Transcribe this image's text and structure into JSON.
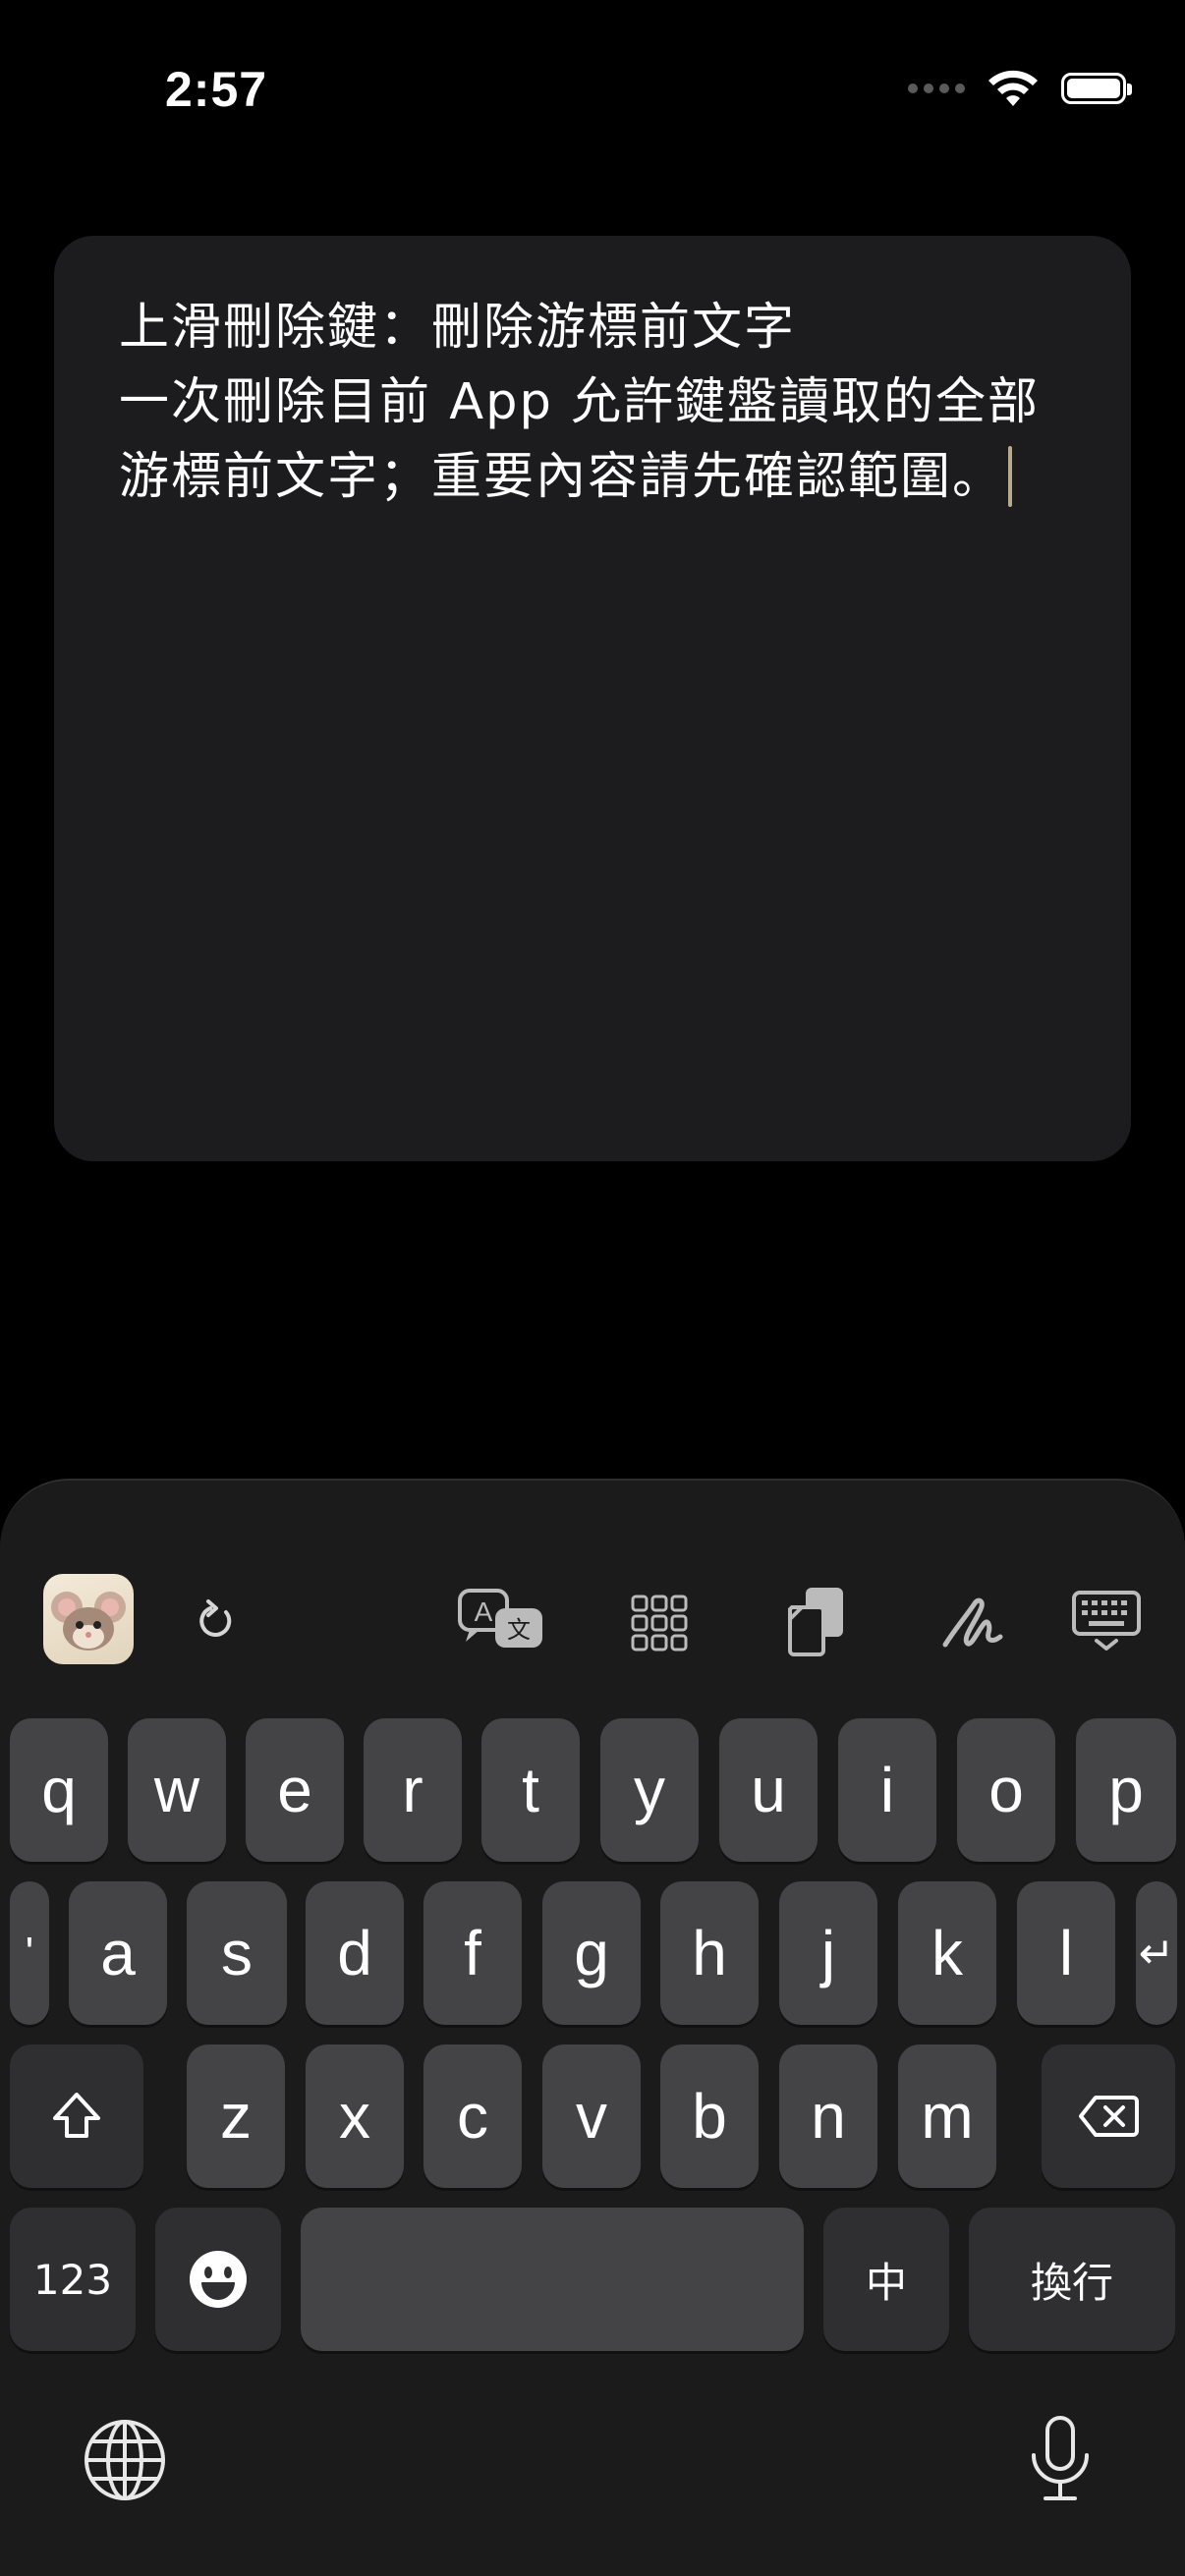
{
  "status_bar": {
    "time": "2:57"
  },
  "text_area": {
    "content": "上滑刪除鍵：刪除游標前文字\n一次刪除目前 App 允許鍵盤讀取的全部游標前文字；重要內容請先確認範圍。"
  },
  "keyboard": {
    "toolbar": {
      "icons": [
        "mouse-avatar-icon",
        "refresh-icon",
        "translate-icon",
        "grid-apps-icon",
        "clipboard-icon",
        "handwriting-icon",
        "hide-keyboard-icon"
      ]
    },
    "row1": [
      "q",
      "w",
      "e",
      "r",
      "t",
      "y",
      "u",
      "i",
      "o",
      "p"
    ],
    "row2": [
      "'",
      "a",
      "s",
      "d",
      "f",
      "g",
      "h",
      "j",
      "k",
      "l"
    ],
    "row2_return_symbol": "↵",
    "row3": [
      "z",
      "x",
      "c",
      "v",
      "b",
      "n",
      "m"
    ],
    "numbers_label": "123",
    "space_label": "",
    "language_label": "中",
    "return_label": "換行"
  },
  "colors": {
    "background": "#000000",
    "card": "#1c1c1e",
    "key": "#444446",
    "function_key": "#2f2f31",
    "caret": "#b8a98a"
  }
}
